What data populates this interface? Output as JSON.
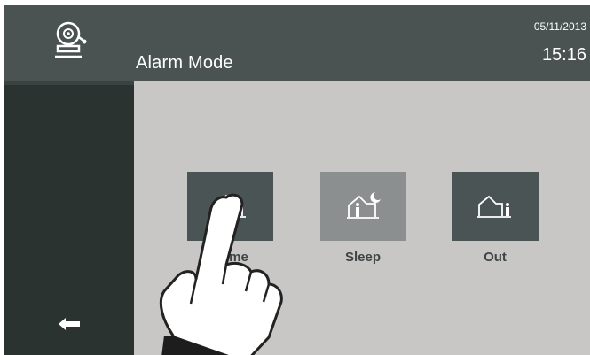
{
  "header": {
    "title": "Alarm Mode",
    "date": "05/11/2013",
    "time": "15:16",
    "icon": "bell-icon"
  },
  "sidebar": {
    "back_icon": "arrow-left-icon"
  },
  "modes": [
    {
      "label": "Home",
      "icon": "house-icon",
      "selected": true
    },
    {
      "label": "Sleep",
      "icon": "house-moon-icon",
      "selected": false
    },
    {
      "label": "Out",
      "icon": "house-person-out-icon",
      "selected": false
    }
  ],
  "overlay": {
    "icon": "pointing-hand-icon"
  },
  "colors": {
    "header_bg": "#4a5252",
    "sidebar_bg": "#2b3331",
    "main_bg": "#c9c6c6",
    "tile_dark": "#4b5454",
    "tile_light": "#8b8f8f",
    "label_text": "#3e4645"
  }
}
